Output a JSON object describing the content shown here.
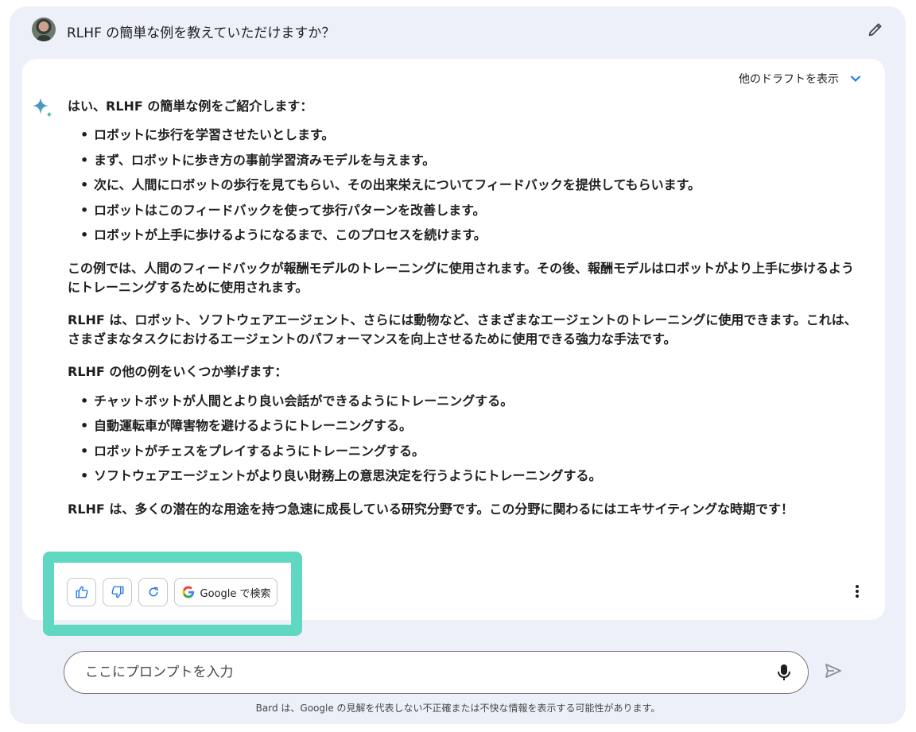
{
  "prompt": {
    "text": "RLHF の簡単な例を教えていただけますか？",
    "avatar_icon": "user-avatar",
    "edit_icon": "pencil-icon"
  },
  "response": {
    "drafts_label": "他のドラフトを表示",
    "intro": "はい、RLHF の簡単な例をご紹介します：",
    "steps": [
      "ロボットに歩行を学習させたいとします。",
      "まず、ロボットに歩き方の事前学習済みモデルを与えます。",
      "次に、人間にロボットの歩行を見てもらい、その出来栄えについてフィードバックを提供してもらいます。",
      "ロボットはこのフィードバックを使って歩行パターンを改善します。",
      "ロボットが上手に歩けるようになるまで、このプロセスを続けます。"
    ],
    "para1": "この例では、人間のフィードバックが報酬モデルのトレーニングに使用されます。その後、報酬モデルはロボットがより上手に歩けるようにトレーニングするために使用されます。",
    "para2": "RLHF は、ロボット、ソフトウェアエージェント、さらには動物など、さまざまなエージェントのトレーニングに使用できます。これは、さまざまなタスクにおけるエージェントのパフォーマンスを向上させるために使用できる強力な手法です。",
    "para3": "RLHF の他の例をいくつか挙げます：",
    "examples": [
      "チャットボットが人間とより良い会話ができるようにトレーニングする。",
      "自動運転車が障害物を避けるようにトレーニングする。",
      "ロボットがチェスをプレイするようにトレーニングする。",
      "ソフトウェアエージェントがより良い財務上の意思決定を行うようにトレーニングする。"
    ],
    "conclusion": "RLHF は、多くの潜在的な用途を持つ急速に成長している研究分野です。この分野に関わるにはエキサイティングな時期です！"
  },
  "actions": {
    "like_icon": "thumbs-up-icon",
    "dislike_icon": "thumbs-down-icon",
    "regenerate_icon": "refresh-icon",
    "google_label": "Google で検索",
    "more_icon": "more-vertical-icon"
  },
  "input": {
    "placeholder": "ここにプロンプトを入力",
    "mic_icon": "microphone-icon",
    "send_icon": "send-icon"
  },
  "disclaimer": "Bard は、Google の見解を代表しない不正確または不快な情報を表示する可能性があります。",
  "colors": {
    "highlight": "#5fd7c1",
    "page_bg": "#edf0f8",
    "card_bg": "#ffffff",
    "accent_blue": "#1a73e8"
  }
}
